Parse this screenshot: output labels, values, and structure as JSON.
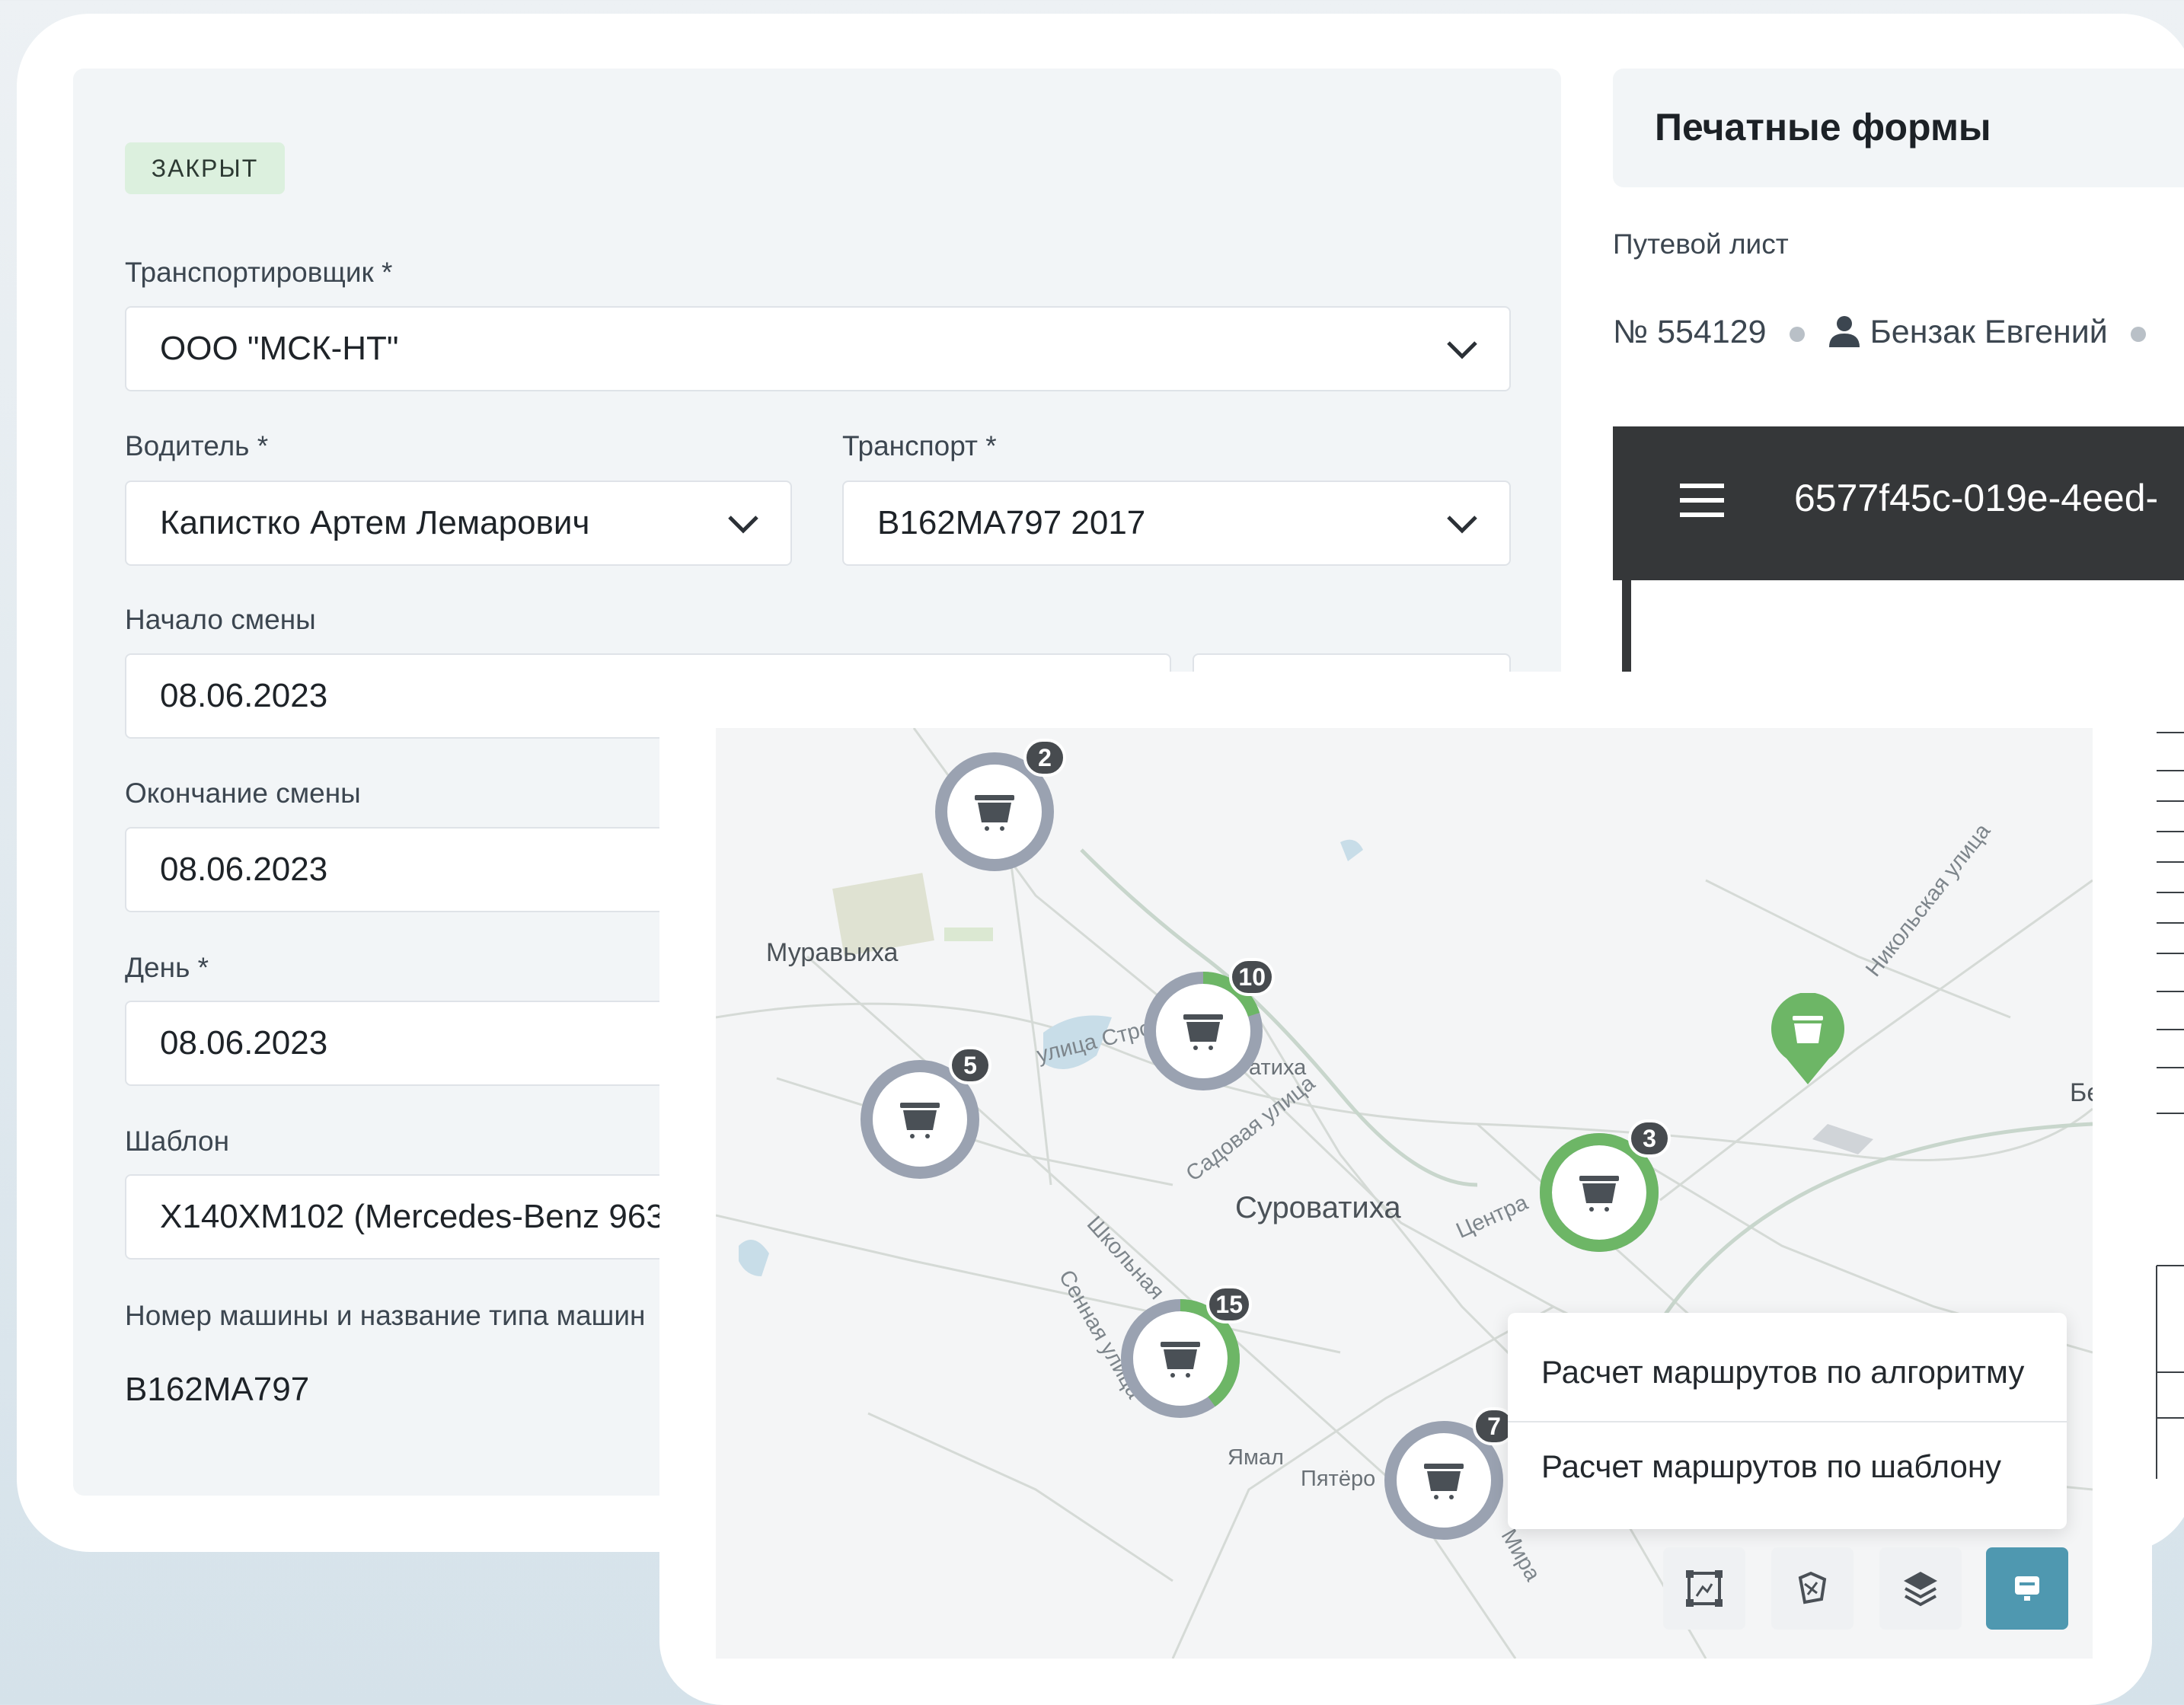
{
  "form": {
    "status_badge": "ЗАКРЫТ",
    "carrier": {
      "label": "Транспортировщик *",
      "value": "ООО \"МСК-НТ\""
    },
    "driver": {
      "label": "Водитель *",
      "value": "Капистко Артем Лемарович"
    },
    "transport": {
      "label": "Транспорт *",
      "value": "В162МА797 2017"
    },
    "shift_start": {
      "label": "Начало смены",
      "value": "08.06.2023"
    },
    "shift_end": {
      "label": "Окончание смены",
      "value": "08.06.2023"
    },
    "day": {
      "label": "День *",
      "value": "08.06.2023"
    },
    "template": {
      "label": "Шаблон",
      "value": "Х140ХМ102 (Mercedes-Benz 963"
    },
    "vehicle_name": {
      "label": "Номер машины и название типа машин",
      "value": "В162МА797"
    }
  },
  "print_forms": {
    "title": "Печатные формы",
    "waybill_label": "Путевой лист",
    "number": "№ 554129",
    "person": "Бензак Евгений",
    "doc_id": "6577f45c-019e-4eed-"
  },
  "map": {
    "labels": {
      "muravikha": "Муравьиха",
      "street_stroi": "улица Стро",
      "atikha": "атиха",
      "sadovaya": "Садовая улица",
      "surovatikha": "Суроватиха",
      "centr": "Центра",
      "shkolnaya": "Школьная",
      "sennaya": "Сенная улица",
      "yamal": "Ямал",
      "pyatyoro": "Пятёро",
      "mira": "Мира",
      "nikolskaya": "Никольская улица",
      "be": "Бе"
    },
    "clusters": [
      {
        "count": "2",
        "progress": 0
      },
      {
        "count": "10",
        "progress": 0.2
      },
      {
        "count": "5",
        "progress": 0
      },
      {
        "count": "3",
        "progress": 1
      },
      {
        "count": "15",
        "progress": 0.4
      },
      {
        "count": "7",
        "progress": 0
      }
    ],
    "menu": {
      "by_algorithm": "Расчет маршрутов по алгоритму",
      "by_template": "Расчет маршрутов по шаблону"
    },
    "toolbar_icons": [
      "select-area-icon",
      "map-polygon-icon",
      "layers-icon",
      "truck-icon"
    ]
  },
  "colors": {
    "accent_green": "#6db666",
    "status_badge_bg": "#dcf0de",
    "active_tool": "#4f98b0",
    "ring_gray": "#9aa2b1"
  }
}
